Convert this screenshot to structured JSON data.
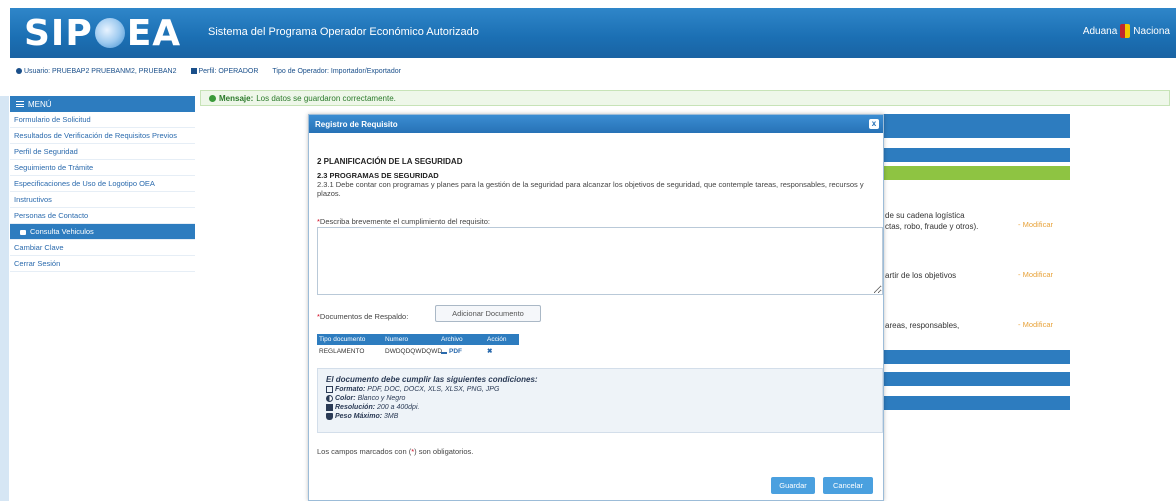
{
  "header": {
    "logo_left": "SIP",
    "logo_right": "EA",
    "title": "Sistema del Programa Operador Económico Autorizado",
    "brand": "Aduana",
    "brand_suffix": "Naciona"
  },
  "userbar": {
    "user": "Usuario: PRUEBAP2 PRUEBANM2, PRUEBAN2",
    "profile": "Perfil: OPERADOR",
    "operator_type": "Tipo de Operador: Importador/Exportador"
  },
  "sidebar": {
    "menu_label": "MENÚ",
    "items": [
      {
        "label": "Formulario de Solicitud"
      },
      {
        "label": "Resultados de Verificación de Requisitos Previos"
      },
      {
        "label": "Perfil de Seguridad"
      },
      {
        "label": "Seguimiento de Trámite"
      },
      {
        "label": "Especificaciones de Uso de Logotipo OEA"
      },
      {
        "label": "Instructivos"
      },
      {
        "label": "Personas de Contacto"
      },
      {
        "label": "Consulta Vehiculos"
      },
      {
        "label": "Cambiar Clave"
      },
      {
        "label": "Cerrar Sesión"
      }
    ]
  },
  "message": {
    "prefix": "Mensaje:",
    "text": "Los datos se guardaron correctamente."
  },
  "background": {
    "row1_text": "de su cadena logística",
    "row1_text2": "ctas, robo, fraude y otros).",
    "row2_text": "artir de los objetivos",
    "row3_text": "areas, responsables,",
    "modify": "Modificar"
  },
  "modal": {
    "title": "Registro de Requisito",
    "close": "x",
    "section": "2 PLANIFICACIÓN DE LA SEGURIDAD",
    "subsection": "2.3 PROGRAMAS DE SEGURIDAD",
    "description": "2.3.1 Debe contar con programas y planes para la gestión de la seguridad para alcanzar los objetivos de seguridad, que contemple tareas, responsables, recursos y plazos.",
    "desc_label": "Describa brevemente el cumplimiento del requisito:",
    "textarea_value": "",
    "docs_label": "Documentos de Respaldo:",
    "add_doc_button": "Adicionar Documento",
    "required_mark": "*",
    "table": {
      "headers": [
        "Tipo documento",
        "Numero",
        "Archivo",
        "Acción"
      ],
      "rows": [
        {
          "tipo": "REGLAMENTO",
          "numero": "DWDQDQWDQWD",
          "archivo": "PDF",
          "accion": "✖"
        }
      ]
    },
    "conditions": {
      "title": "El documento debe cumplir las siguientes condiciones:",
      "format_label": "Formato:",
      "format_value": "PDF, DOC, DOCX, XLS, XLSX, PNG, JPG",
      "color_label": "Color:",
      "color_value": "Blanco y Negro",
      "resolution_label": "Resolución:",
      "resolution_value": "200 a 400dpi.",
      "weight_label": "Peso Máximo:",
      "weight_value": "3MB"
    },
    "required_note_prefix": "Los campos marcados con (",
    "required_note_suffix": ") son obligatorios.",
    "save_button": "Guardar",
    "cancel_button": "Cancelar"
  }
}
